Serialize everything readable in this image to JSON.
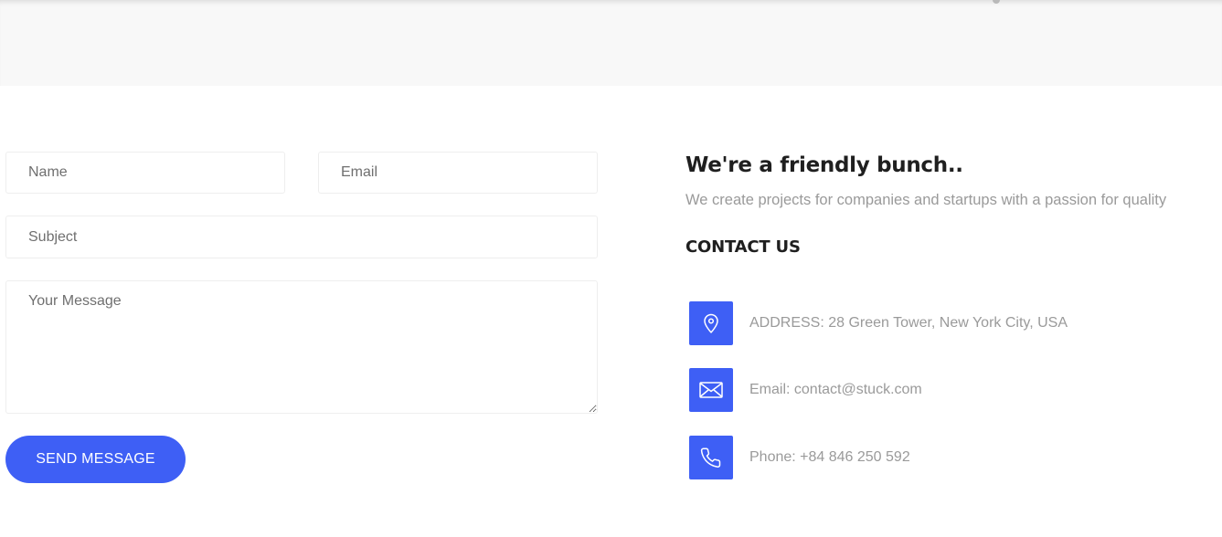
{
  "form": {
    "name_placeholder": "Name",
    "email_placeholder": "Email",
    "subject_placeholder": "Subject",
    "message_placeholder": "Your Message",
    "send_label": "SEND MESSAGE"
  },
  "info": {
    "title": "We're a friendly bunch..",
    "subtitle": "We create projects for companies and startups with a passion for quality",
    "contact_heading": "CONTACT US",
    "items": [
      {
        "icon": "map-pin-icon",
        "text": "ADDRESS: 28 Green Tower, New York City, USA"
      },
      {
        "icon": "envelope-icon",
        "text": "Email: contact@stuck.com"
      },
      {
        "icon": "phone-icon",
        "text": "Phone: +84 846 250 592"
      }
    ]
  },
  "colors": {
    "accent": "#3e5ff5",
    "muted_text": "#9a9a9a",
    "heading_text": "#1f1f1f",
    "top_band": "#f8f8f8"
  }
}
